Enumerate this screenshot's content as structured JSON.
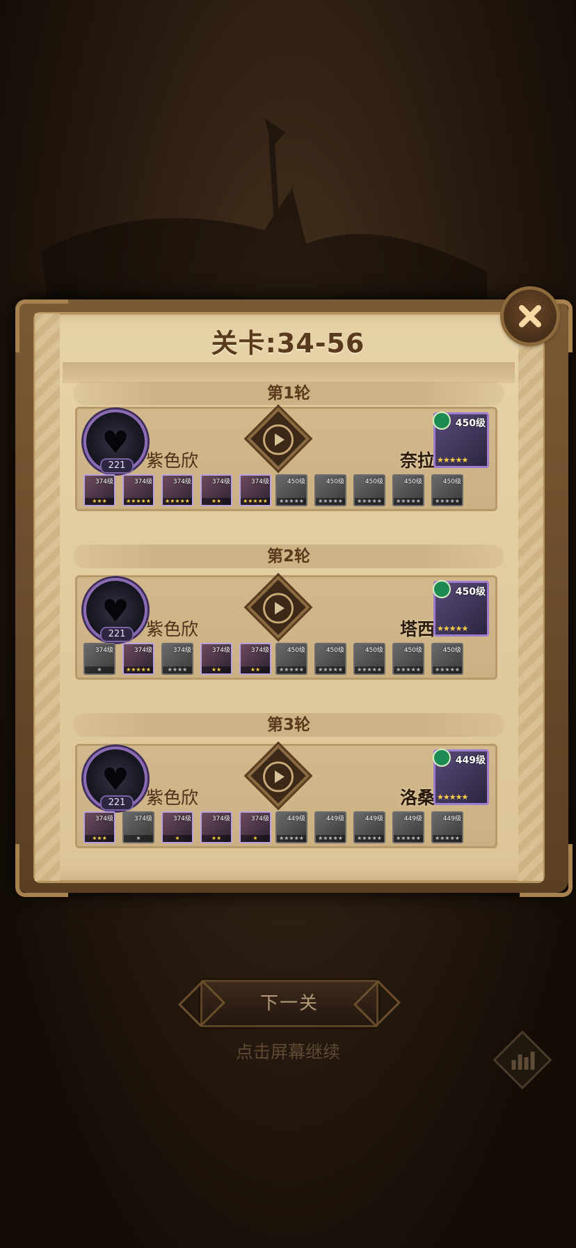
{
  "stage": {
    "title": "关卡:34-56"
  },
  "buttons": {
    "close_icon": "close-icon",
    "next_label": "下一关",
    "continue_hint": "点击屏幕继续",
    "stats_icon": "bar-chart-icon"
  },
  "colors": {
    "panel": "#e0c99c",
    "accent": "#5a3a1c",
    "purple_frame": "#8a6bb4",
    "green_gem": "#1c8a52"
  },
  "rounds": [
    {
      "label": "第1轮",
      "player": {
        "name": "紫色欣",
        "level": "221"
      },
      "enemy": {
        "name": "奈拉",
        "level": "450级",
        "stars": "★★★★★"
      },
      "player_heroes": [
        {
          "level": "374级",
          "stars": "★★★",
          "gray": false
        },
        {
          "level": "374级",
          "stars": "★★★★★",
          "gray": false
        },
        {
          "level": "374级",
          "stars": "★★★★★",
          "gray": false
        },
        {
          "level": "374级",
          "stars": "★★",
          "gray": false
        },
        {
          "level": "374级",
          "stars": "★★★★★",
          "gray": false
        }
      ],
      "enemy_heroes": [
        {
          "level": "450级",
          "stars": "★★★★★"
        },
        {
          "level": "450级",
          "stars": "★★★★★"
        },
        {
          "level": "450级",
          "stars": "★★★★★"
        },
        {
          "level": "450级",
          "stars": "★★★★★"
        },
        {
          "level": "450级",
          "stars": "★★★★★"
        }
      ]
    },
    {
      "label": "第2轮",
      "player": {
        "name": "紫色欣",
        "level": "221"
      },
      "enemy": {
        "name": "塔西",
        "level": "450级",
        "stars": "★★★★★"
      },
      "player_heroes": [
        {
          "level": "374级",
          "stars": "★",
          "gray": true
        },
        {
          "level": "374级",
          "stars": "★★★★★",
          "gray": false
        },
        {
          "level": "374级",
          "stars": "★★★★",
          "gray": true
        },
        {
          "level": "374级",
          "stars": "★★",
          "gray": false
        },
        {
          "level": "374级",
          "stars": "★★",
          "gray": false
        }
      ],
      "enemy_heroes": [
        {
          "level": "450级",
          "stars": "★★★★★"
        },
        {
          "level": "450级",
          "stars": "★★★★★"
        },
        {
          "level": "450级",
          "stars": "★★★★★"
        },
        {
          "level": "450级",
          "stars": "★★★★★"
        },
        {
          "level": "450级",
          "stars": "★★★★★"
        }
      ]
    },
    {
      "label": "第3轮",
      "player": {
        "name": "紫色欣",
        "level": "221"
      },
      "enemy": {
        "name": "洛桑",
        "level": "449级",
        "stars": "★★★★★"
      },
      "player_heroes": [
        {
          "level": "374级",
          "stars": "★★★",
          "gray": false
        },
        {
          "level": "374级",
          "stars": "★",
          "gray": true
        },
        {
          "level": "374级",
          "stars": "★",
          "gray": false
        },
        {
          "level": "374级",
          "stars": "★★",
          "gray": false
        },
        {
          "level": "374级",
          "stars": "★",
          "gray": false
        }
      ],
      "enemy_heroes": [
        {
          "level": "449级",
          "stars": "★★★★★"
        },
        {
          "level": "449级",
          "stars": "★★★★★"
        },
        {
          "level": "449级",
          "stars": "★★★★★"
        },
        {
          "level": "449级",
          "stars": "★★★★★"
        },
        {
          "level": "449级",
          "stars": "★★★★★"
        }
      ]
    }
  ]
}
